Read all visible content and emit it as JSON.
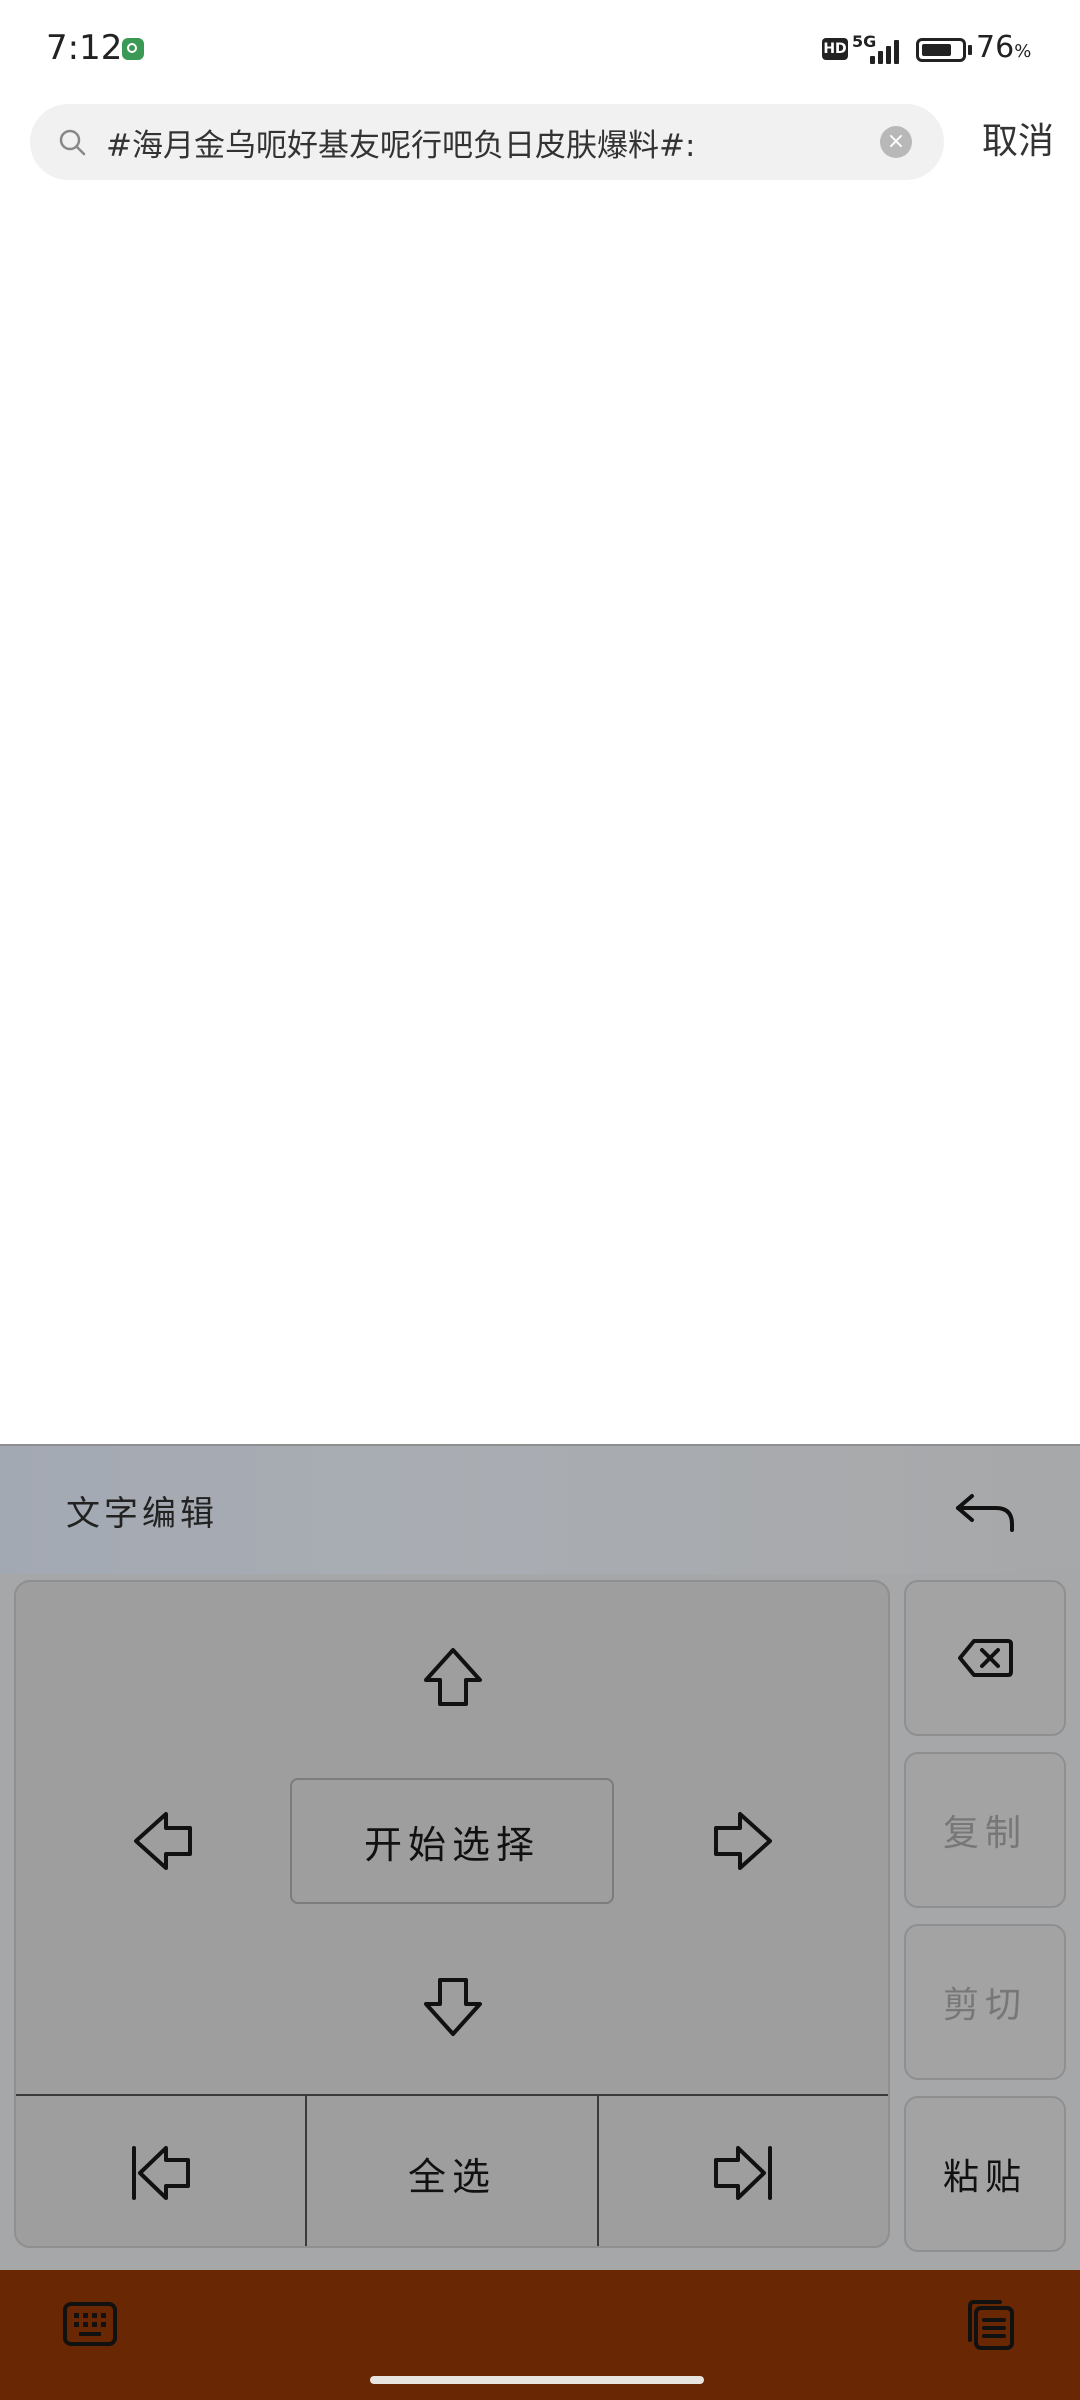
{
  "status_bar": {
    "time": "7:12",
    "network": "5G",
    "hd": "HD",
    "battery_percent": "76",
    "battery_unit": "%",
    "battery_level": 0.76
  },
  "search": {
    "value": "#海月金乌呃好基友呢行吧负日皮肤爆料#:",
    "cancel_label": "取消"
  },
  "keyboard": {
    "title": "文字编辑",
    "start_select_label": "开始选择",
    "select_all_label": "全选",
    "side_keys": {
      "copy_label": "复制",
      "cut_label": "剪切",
      "paste_label": "粘贴"
    },
    "colors": {
      "panel_bg": "#a6a7a8",
      "bottom_bar": "#6a2703"
    }
  }
}
